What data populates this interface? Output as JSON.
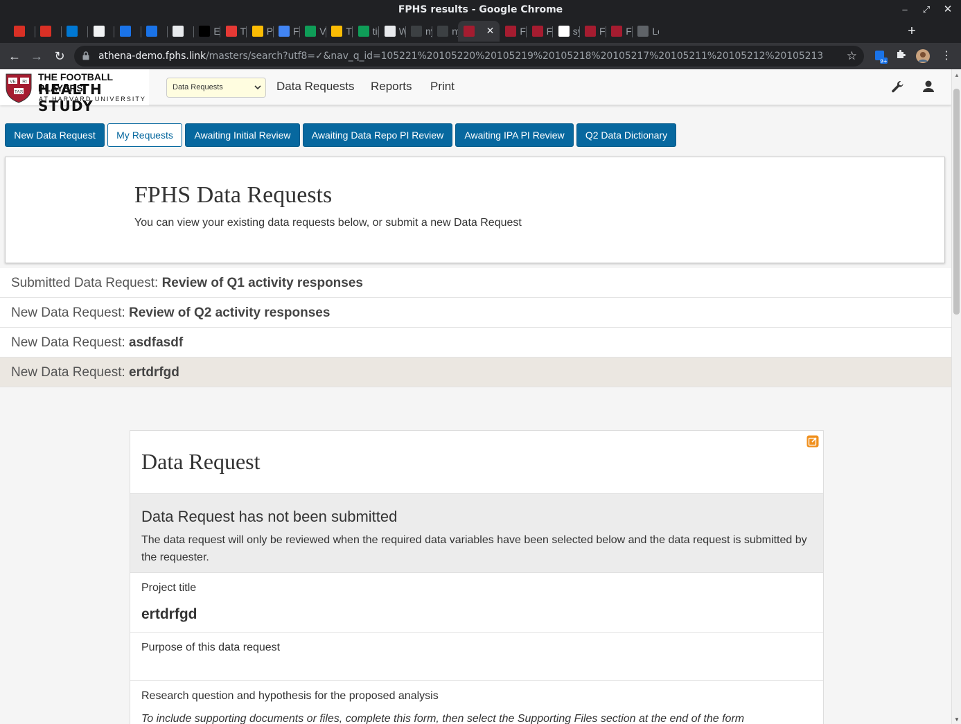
{
  "browser": {
    "window_title": "FPHS results - Google Chrome",
    "tabs": [
      {
        "label": "",
        "favicon": "gmail-icon",
        "color": "#d93025"
      },
      {
        "label": "",
        "favicon": "gmail-icon",
        "color": "#d93025"
      },
      {
        "label": "",
        "favicon": "outlook-icon",
        "color": "#0078d4"
      },
      {
        "label": "",
        "favicon": "book-icon",
        "color": "#f1f3f4"
      },
      {
        "label": "",
        "favicon": "calendar-icon",
        "color": "#1a73e8"
      },
      {
        "label": "",
        "favicon": "calendar-icon",
        "color": "#1a73e8"
      },
      {
        "label": "",
        "favicon": "slack-icon",
        "color": "#e8eaed"
      },
      {
        "label": "Eth",
        "favicon": "info-icon",
        "color": "#000000"
      },
      {
        "label": "The",
        "favicon": "ticket-icon",
        "color": "#e53935"
      },
      {
        "label": "PIT",
        "favicon": "drive-icon",
        "color": "#fbbc04"
      },
      {
        "label": "FPI",
        "favicon": "docs-icon",
        "color": "#4285f4"
      },
      {
        "label": "VN",
        "favicon": "sheets-icon",
        "color": "#0f9d58"
      },
      {
        "label": "Tin",
        "favicon": "drive-icon",
        "color": "#fbbc04"
      },
      {
        "label": "tim",
        "favicon": "sheets-icon",
        "color": "#0f9d58"
      },
      {
        "label": "We",
        "favicon": "nyt-icon",
        "color": "#e8eaed"
      },
      {
        "label": "nyt",
        "favicon": "github-icon",
        "color": "#3c4043"
      },
      {
        "label": "nyt",
        "favicon": "github-icon",
        "color": "#3c4043"
      },
      {
        "label": "",
        "favicon": "harvard-icon",
        "color": "#a51c30",
        "active": true
      },
      {
        "label": "FPI",
        "favicon": "harvard-icon",
        "color": "#a51c30"
      },
      {
        "label": "FPI",
        "favicon": "harvard-icon",
        "color": "#a51c30"
      },
      {
        "label": "syn",
        "favicon": "google-icon",
        "color": "#ffffff"
      },
      {
        "label": "FPI",
        "favicon": "harvard-icon",
        "color": "#a51c30"
      },
      {
        "label": "FPI",
        "favicon": "harvard-icon",
        "color": "#a51c30"
      },
      {
        "label": "Lor",
        "favicon": "page-icon",
        "color": "#5f6368"
      }
    ],
    "url_host": "athena-demo.fphs.link",
    "url_rest": "/masters/search?utf8=✓&nav_q_id=105221%20105220%20105219%20105218%20105217%20105211%20105212%20105213",
    "extension_badge": "9+"
  },
  "app": {
    "logo": {
      "line1": "THE FOOTBALL PLAYERS",
      "line2": "HEALTH STUDY",
      "line3": "AT HARVARD UNIVERSITY",
      "shield_text": [
        "VE",
        "RI",
        "TAS"
      ]
    },
    "select_value": "Data Requests",
    "nav": [
      "Data Requests",
      "Reports",
      "Print"
    ],
    "tab_buttons": [
      "New Data Request",
      "My Requests",
      "Awaiting Initial Review",
      "Awaiting Data Repo PI Review",
      "Awaiting IPA PI Review",
      "Q2 Data Dictionary"
    ],
    "intro_title": "FPHS Data Requests",
    "intro_text": "You can view your existing data requests below, or submit a new Data Request",
    "requests": [
      {
        "prefix": "Submitted Data Request: ",
        "name": "Review of Q1 activity responses"
      },
      {
        "prefix": "New Data Request: ",
        "name": "Review of Q2 activity responses"
      },
      {
        "prefix": "New Data Request: ",
        "name": "asdfasdf"
      },
      {
        "prefix": "New Data Request: ",
        "name": "ertdrfgd"
      }
    ],
    "card": {
      "title": "Data Request",
      "notice_title": "Data Request has not been submitted",
      "notice_text": "The data request will only be reviewed when the required data variables have been selected below and the data request is submitted by the requester.",
      "project_title_label": "Project title",
      "project_title_value": "ertdrfgd",
      "purpose_label": "Purpose of this data request",
      "research_label": "Research question and hypothesis for the proposed analysis",
      "research_note": "To include supporting documents or files, complete this form, then select the Supporting Files section at the end of the form"
    },
    "colors": {
      "primary": "#07689f",
      "selected_row": "#ebe7e1",
      "edit_icon": "#f0901e"
    }
  }
}
